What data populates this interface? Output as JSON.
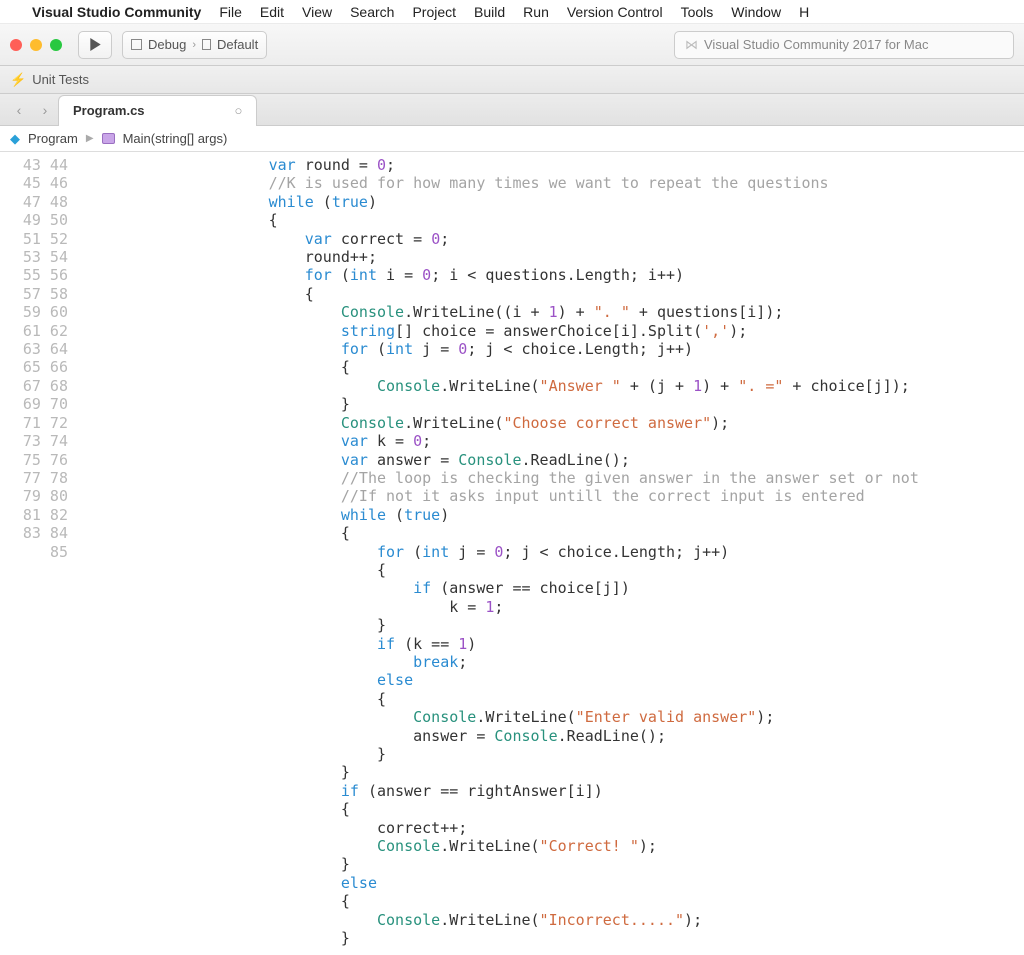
{
  "menubar": {
    "appname": "Visual Studio Community",
    "items": [
      "File",
      "Edit",
      "View",
      "Search",
      "Project",
      "Build",
      "Run",
      "Version Control",
      "Tools",
      "Window",
      "H"
    ]
  },
  "toolbar": {
    "config_label": "Debug",
    "target_label": "Default",
    "search_placeholder": "Visual Studio Community 2017 for Mac"
  },
  "utbar": {
    "label": "Unit Tests"
  },
  "tab": {
    "filename": "Program.cs"
  },
  "breadcrumb": {
    "class": "Program",
    "method": "Main(string[] args)"
  },
  "code": {
    "first_line": 43,
    "lines": [
      {
        "i": 5,
        "tok": [
          [
            "kw",
            "var"
          ],
          [
            "",
            " round = "
          ],
          [
            "num",
            "0"
          ],
          [
            "",
            ";"
          ]
        ]
      },
      {
        "i": 5,
        "tok": [
          [
            "com",
            "//K is used for how many times we want to repeat the questions"
          ]
        ]
      },
      {
        "i": 5,
        "tok": [
          [
            "kw",
            "while"
          ],
          [
            "",
            " ("
          ],
          [
            "kw",
            "true"
          ],
          [
            "",
            ")"
          ]
        ]
      },
      {
        "i": 5,
        "tok": [
          [
            "",
            "{"
          ]
        ]
      },
      {
        "i": 6,
        "tok": [
          [
            "kw",
            "var"
          ],
          [
            "",
            " correct = "
          ],
          [
            "num",
            "0"
          ],
          [
            "",
            ";"
          ]
        ]
      },
      {
        "i": 6,
        "tok": [
          [
            "",
            "round++;"
          ]
        ]
      },
      {
        "i": 6,
        "tok": [
          [
            "kw",
            "for"
          ],
          [
            "",
            " ("
          ],
          [
            "kw",
            "int"
          ],
          [
            "",
            " i = "
          ],
          [
            "num",
            "0"
          ],
          [
            "",
            "; i < questions.Length; i++)"
          ]
        ]
      },
      {
        "i": 6,
        "tok": [
          [
            "",
            "{"
          ]
        ]
      },
      {
        "i": 7,
        "tok": [
          [
            "cls",
            "Console"
          ],
          [
            "",
            ".WriteLine((i + "
          ],
          [
            "num",
            "1"
          ],
          [
            "",
            ") + "
          ],
          [
            "str",
            "\". \""
          ],
          [
            "",
            " + questions[i]);"
          ]
        ]
      },
      {
        "i": 7,
        "tok": [
          [
            "kw",
            "string"
          ],
          [
            "",
            "[] choice = answerChoice[i].Split("
          ],
          [
            "chr",
            "','"
          ],
          [
            "",
            ");"
          ]
        ]
      },
      {
        "i": 7,
        "tok": [
          [
            "kw",
            "for"
          ],
          [
            "",
            " ("
          ],
          [
            "kw",
            "int"
          ],
          [
            "",
            " j = "
          ],
          [
            "num",
            "0"
          ],
          [
            "",
            "; j < choice.Length; j++)"
          ]
        ]
      },
      {
        "i": 7,
        "tok": [
          [
            "",
            "{"
          ]
        ]
      },
      {
        "i": 8,
        "tok": [
          [
            "cls",
            "Console"
          ],
          [
            "",
            ".WriteLine("
          ],
          [
            "str",
            "\"Answer \""
          ],
          [
            "",
            " + (j + "
          ],
          [
            "num",
            "1"
          ],
          [
            "",
            ") + "
          ],
          [
            "str",
            "\". =\""
          ],
          [
            "",
            " + choice[j]);"
          ]
        ]
      },
      {
        "i": 7,
        "tok": [
          [
            "",
            "}"
          ]
        ]
      },
      {
        "i": 7,
        "tok": [
          [
            "cls",
            "Console"
          ],
          [
            "",
            ".WriteLine("
          ],
          [
            "str",
            "\"Choose correct answer\""
          ],
          [
            "",
            ");"
          ]
        ]
      },
      {
        "i": 7,
        "tok": [
          [
            "kw",
            "var"
          ],
          [
            "",
            " k = "
          ],
          [
            "num",
            "0"
          ],
          [
            "",
            ";"
          ]
        ]
      },
      {
        "i": 7,
        "tok": [
          [
            "kw",
            "var"
          ],
          [
            "",
            " answer = "
          ],
          [
            "cls",
            "Console"
          ],
          [
            "",
            ".ReadLine();"
          ]
        ]
      },
      {
        "i": 7,
        "tok": [
          [
            "com",
            "//The loop is checking the given answer in the answer set or not"
          ]
        ]
      },
      {
        "i": 7,
        "tok": [
          [
            "com",
            "//If not it asks input untill the correct input is entered"
          ]
        ]
      },
      {
        "i": 7,
        "tok": [
          [
            "kw",
            "while"
          ],
          [
            "",
            " ("
          ],
          [
            "kw",
            "true"
          ],
          [
            "",
            ")"
          ]
        ]
      },
      {
        "i": 7,
        "tok": [
          [
            "",
            "{"
          ]
        ]
      },
      {
        "i": 8,
        "tok": [
          [
            "kw",
            "for"
          ],
          [
            "",
            " ("
          ],
          [
            "kw",
            "int"
          ],
          [
            "",
            " j = "
          ],
          [
            "num",
            "0"
          ],
          [
            "",
            "; j < choice.Length; j++)"
          ]
        ]
      },
      {
        "i": 8,
        "tok": [
          [
            "",
            "{"
          ]
        ]
      },
      {
        "i": 9,
        "tok": [
          [
            "kw",
            "if"
          ],
          [
            "",
            " (answer == choice[j])"
          ]
        ]
      },
      {
        "i": 10,
        "tok": [
          [
            "",
            "k = "
          ],
          [
            "num",
            "1"
          ],
          [
            "",
            ";"
          ]
        ]
      },
      {
        "i": 8,
        "tok": [
          [
            "",
            "}"
          ]
        ]
      },
      {
        "i": 8,
        "tok": [
          [
            "kw",
            "if"
          ],
          [
            "",
            " (k == "
          ],
          [
            "num",
            "1"
          ],
          [
            "",
            ")"
          ]
        ]
      },
      {
        "i": 9,
        "tok": [
          [
            "kw",
            "break"
          ],
          [
            "",
            ";"
          ]
        ]
      },
      {
        "i": 8,
        "tok": [
          [
            "kw",
            "else"
          ]
        ]
      },
      {
        "i": 8,
        "tok": [
          [
            "",
            "{"
          ]
        ]
      },
      {
        "i": 9,
        "tok": [
          [
            "cls",
            "Console"
          ],
          [
            "",
            ".WriteLine("
          ],
          [
            "str",
            "\"Enter valid answer\""
          ],
          [
            "",
            ");"
          ]
        ]
      },
      {
        "i": 9,
        "tok": [
          [
            "",
            "answer = "
          ],
          [
            "cls",
            "Console"
          ],
          [
            "",
            ".ReadLine();"
          ]
        ]
      },
      {
        "i": 8,
        "tok": [
          [
            "",
            "}"
          ]
        ]
      },
      {
        "i": 7,
        "tok": [
          [
            "",
            "}"
          ]
        ]
      },
      {
        "i": 7,
        "tok": [
          [
            "kw",
            "if"
          ],
          [
            "",
            " (answer == rightAnswer[i])"
          ]
        ]
      },
      {
        "i": 7,
        "tok": [
          [
            "",
            "{"
          ]
        ]
      },
      {
        "i": 8,
        "tok": [
          [
            "",
            "correct++;"
          ]
        ]
      },
      {
        "i": 8,
        "tok": [
          [
            "cls",
            "Console"
          ],
          [
            "",
            ".WriteLine("
          ],
          [
            "str",
            "\"Correct! \""
          ],
          [
            "",
            ");"
          ]
        ]
      },
      {
        "i": 7,
        "tok": [
          [
            "",
            "}"
          ]
        ]
      },
      {
        "i": 7,
        "tok": [
          [
            "kw",
            "else"
          ]
        ]
      },
      {
        "i": 7,
        "tok": [
          [
            "",
            "{"
          ]
        ]
      },
      {
        "i": 8,
        "tok": [
          [
            "cls",
            "Console"
          ],
          [
            "",
            ".WriteLine("
          ],
          [
            "str",
            "\"Incorrect.....\""
          ],
          [
            "",
            ");"
          ]
        ]
      },
      {
        "i": 7,
        "tok": [
          [
            "",
            "}"
          ]
        ]
      }
    ]
  }
}
